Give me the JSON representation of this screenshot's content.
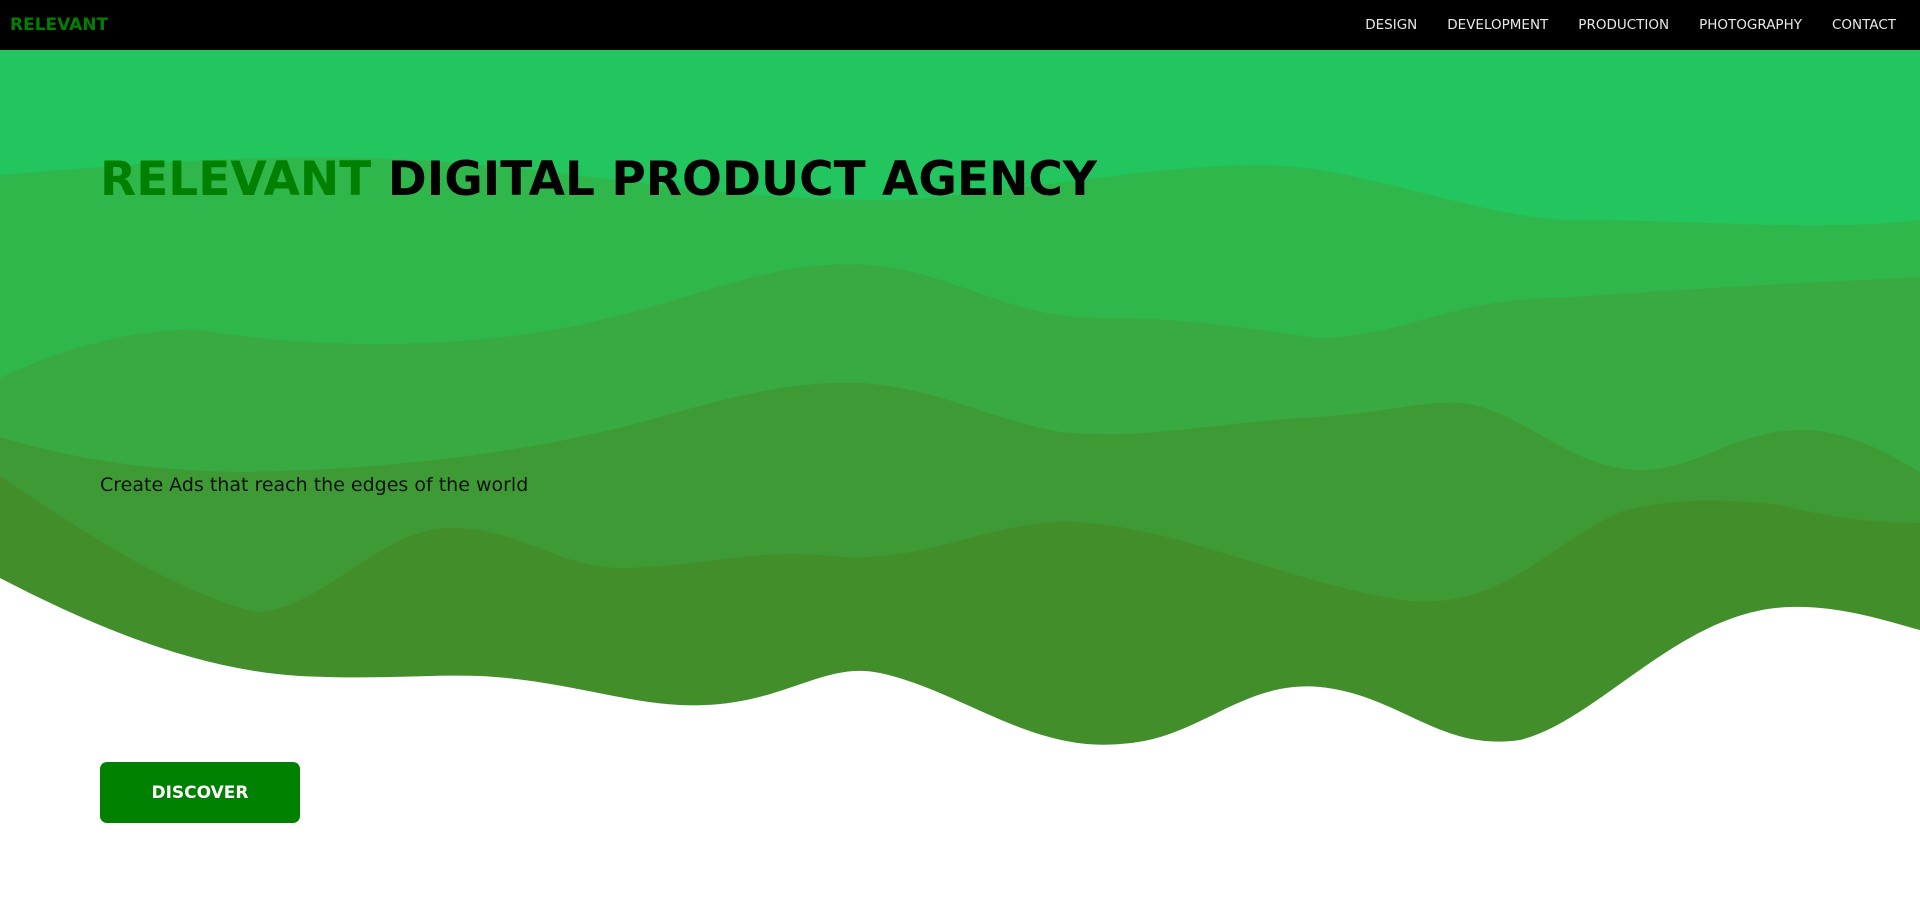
{
  "nav": {
    "logo": "RELEVANT",
    "items": [
      {
        "label": "DESIGN"
      },
      {
        "label": "DEVELOPMENT"
      },
      {
        "label": "PRODUCTION"
      },
      {
        "label": "PHOTOGRAPHY"
      },
      {
        "label": "CONTACT"
      }
    ]
  },
  "hero": {
    "headline_brand": "RELEVANT",
    "headline_rest": "DIGITAL PRODUCT AGENCY",
    "tagline": "Create Ads that reach the edges of the world",
    "cta_label": "DISCOVER"
  },
  "colors": {
    "brand": "#008000",
    "nav_background": "#000000",
    "wave_layers": [
      "#22c55e",
      "#2fb74c",
      "#39a941",
      "#3d9a35",
      "#418e2b"
    ]
  }
}
